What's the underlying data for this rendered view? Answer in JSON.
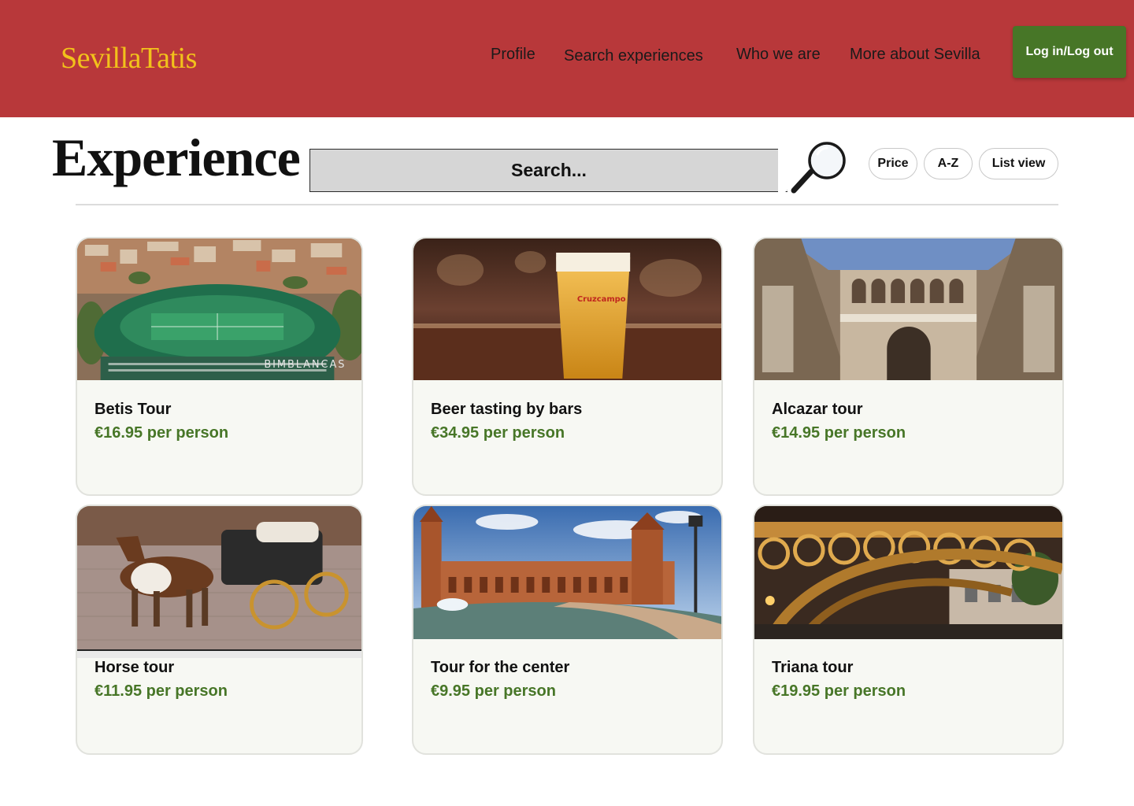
{
  "header": {
    "logo": "SevillaTatis",
    "nav": [
      "Profile",
      "Search experiences",
      "Who we are",
      "More about Sevilla"
    ],
    "login_label": "Log in/Log out"
  },
  "toolbar": {
    "title": "Experience",
    "search_placeholder": "Search...",
    "filters": [
      "Price",
      "A-Z",
      "List view"
    ]
  },
  "experiences": [
    {
      "title": "Betis Tour",
      "price": "€16.95 per person",
      "image": "stadium-aerial-photo",
      "image_text": "BIMBLANCAS"
    },
    {
      "title": "Beer tasting by bars",
      "price": "€34.95 per person",
      "image": "beer-glass-photo",
      "image_text": "Cruzcampo"
    },
    {
      "title": "Alcazar tour",
      "price": "€14.95 per person",
      "image": "alcazar-courtyard-photo"
    },
    {
      "title": "Horse tour",
      "price": "€11.95 per person",
      "image": "horse-carriage-photo"
    },
    {
      "title": "Tour for the center",
      "price": "€9.95 per person",
      "image": "plaza-de-espana-photo"
    },
    {
      "title": "Triana tour",
      "price": "€19.95 per person",
      "image": "triana-bridge-photo"
    }
  ],
  "colors": {
    "header_bg": "#b8383a",
    "logo": "#f2c21b",
    "accent_green": "#477627",
    "card_bg": "#f7f8f3",
    "search_bg": "#d6d6d6"
  }
}
